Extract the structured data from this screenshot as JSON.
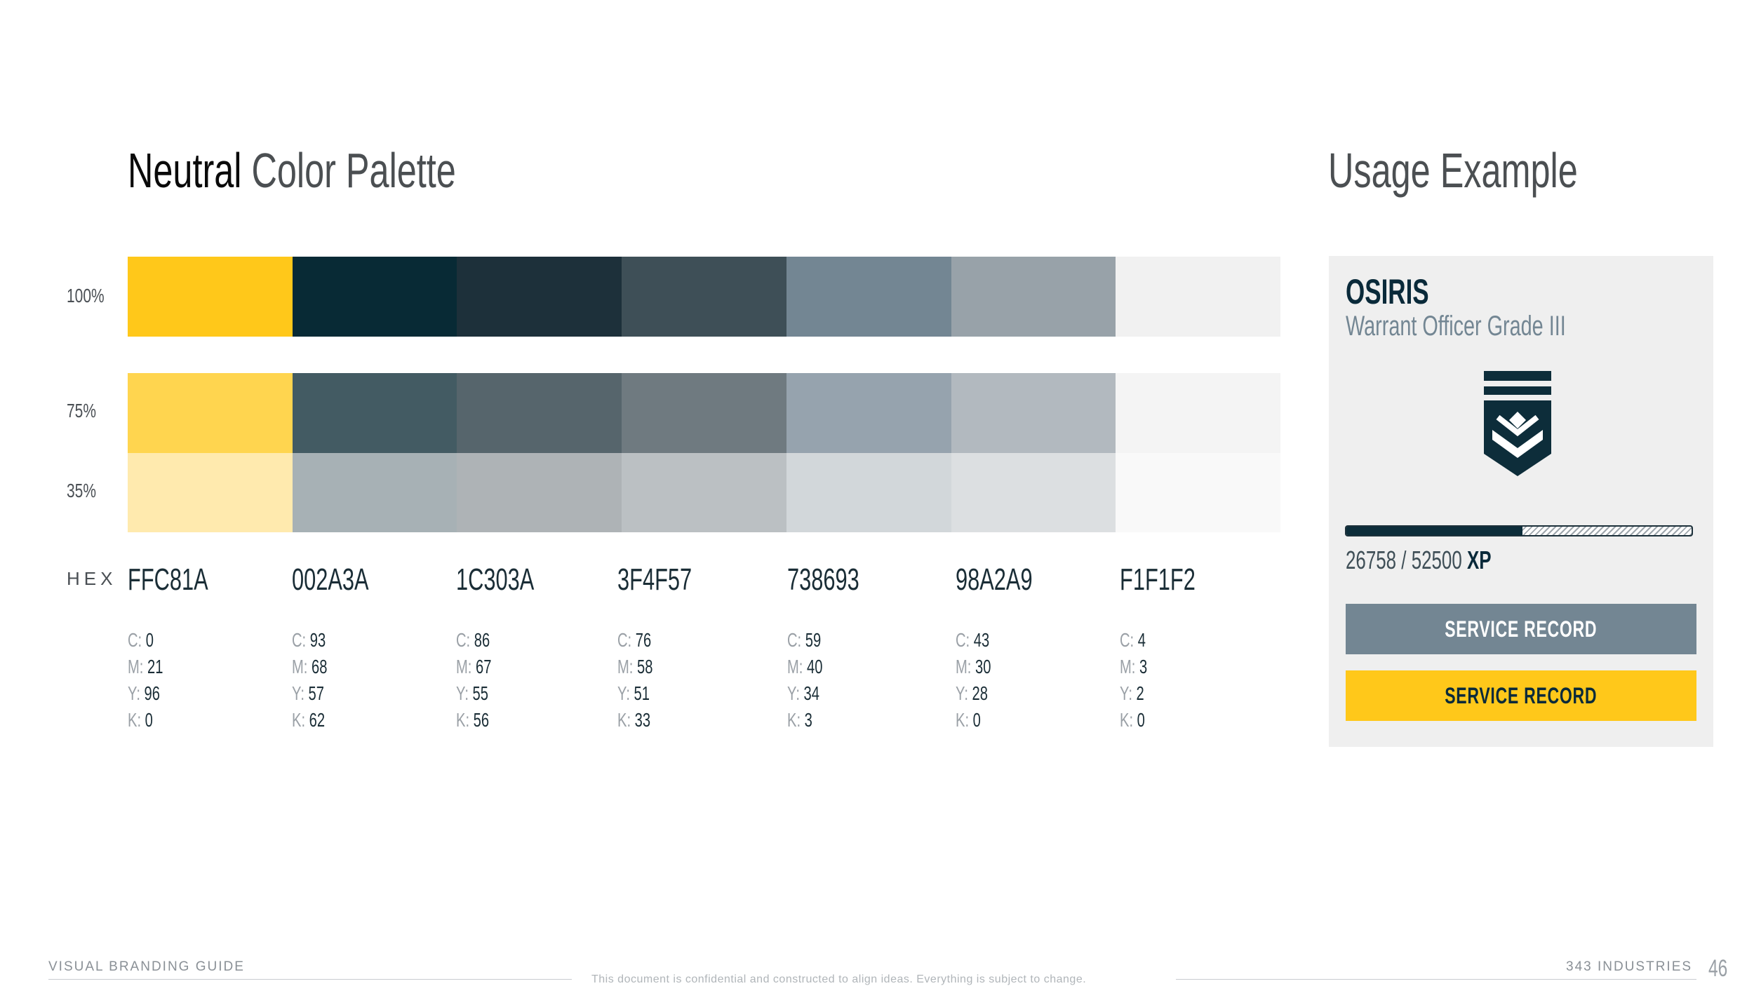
{
  "palette_title": {
    "strong": "Neutral",
    "light": "Color Palette"
  },
  "usage_title": "Usage Example",
  "row_labels": {
    "r100": "100%",
    "r75": "75%",
    "r35": "35%",
    "hex": "HEX"
  },
  "colors": [
    {
      "hex": "FFC81A",
      "c": "0",
      "m": "21",
      "y": "96",
      "k": "0"
    },
    {
      "hex": "002A3A",
      "c": "93",
      "m": "68",
      "y": "57",
      "k": "62"
    },
    {
      "hex": "1C303A",
      "c": "86",
      "m": "67",
      "y": "55",
      "k": "56"
    },
    {
      "hex": "3F4F57",
      "c": "76",
      "m": "58",
      "y": "51",
      "k": "33"
    },
    {
      "hex": "738693",
      "c": "59",
      "m": "40",
      "y": "34",
      "k": "3"
    },
    {
      "hex": "98A2A9",
      "c": "43",
      "m": "30",
      "y": "28",
      "k": "0"
    },
    {
      "hex": "F1F1F2",
      "c": "4",
      "m": "3",
      "y": "2",
      "k": "0"
    }
  ],
  "swatches": {
    "r100": [
      "#ffc81a",
      "#082a35",
      "#1d303a",
      "#3e4f57",
      "#738693",
      "#98a2a9",
      "#f1f1f1"
    ],
    "r75": [
      "#ffd54f",
      "#435b63",
      "#56656c",
      "#6f7a80",
      "#96a3ae",
      "#b2b9bf",
      "#f4f4f4"
    ],
    "r35": [
      "#ffeaae",
      "#a7b1b5",
      "#aeb3b6",
      "#bbc0c3",
      "#d2d7da",
      "#dcdfe1",
      "#f9f9f9"
    ]
  },
  "cmyk_keys": {
    "c": "C:",
    "m": "M:",
    "y": "Y:",
    "k": "K:"
  },
  "card": {
    "name": "OSIRIS",
    "rank": "Warrant Officer Grade III",
    "xp_current": "26758",
    "xp_sep": " / ",
    "xp_total": "52500",
    "xp_unit": "XP",
    "xp_progress": 0.5097,
    "button_primary": "SERVICE RECORD",
    "button_secondary": "SERVICE RECORD",
    "icon": "warrant-officer-insignia-icon"
  },
  "footer": {
    "left": "VISUAL BRANDING GUIDE",
    "center": "This document is confidential and constructed to align ideas.  Everything is subject to change.",
    "right": "343 INDUSTRIES",
    "page": "46"
  }
}
